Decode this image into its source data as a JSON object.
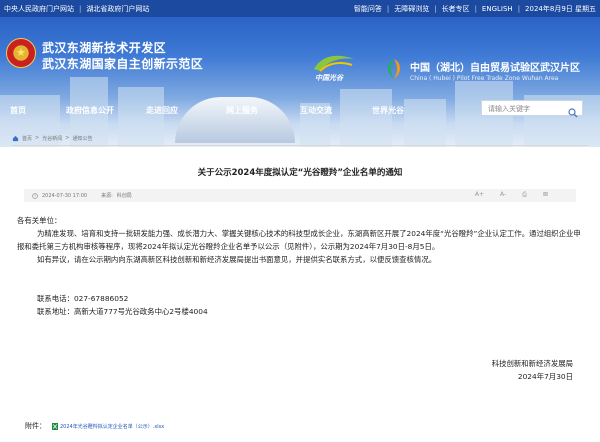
{
  "topbar": {
    "left_links": [
      "中央人民政府门户网站",
      "湖北省政府门户网站"
    ],
    "right_links": [
      "智能问答",
      "无障碍浏览",
      "长者专区",
      "ENGLISH"
    ],
    "date": "2024年8月9日 星期五"
  },
  "header": {
    "title_line1": "武汉东湖新技术开发区",
    "title_line2": "武汉东湖国家自主创新示范区",
    "optics_valley_logo_text": "中国光谷",
    "ftz_title": "中国（湖北）自由贸易试验区武汉片区",
    "ftz_subtitle": "China ( Hubei ) Pilot Free Trade Zone Wuhan Area",
    "emblem_star": "★"
  },
  "nav": {
    "items": [
      "首页",
      "政府信息公开",
      "走进回应",
      "网上服务",
      "互动交流",
      "世界光谷"
    ]
  },
  "search": {
    "placeholder": "请输入关键字"
  },
  "breadcrumb": [
    "首页",
    "光谷新闻",
    "通知公告"
  ],
  "article": {
    "title": "关于公示2024年度拟认定“光谷瞪羚”企业名单的通知",
    "date": "2024-07-30 17:00",
    "source_label": "来源:",
    "source": "科创局",
    "tools": [
      "A+",
      "A-",
      "⎙",
      "⊠"
    ],
    "salutation": "各有关单位：",
    "paragraph1": "为精准发现、培育和支持一批研发能力强、成长潜力大、掌握关键核心技术的科技型成长企业，东湖高新区开展了2024年度“光谷瞪羚”企业认定工作。通过组织企业申报和委托第三方机构审核等程序，现将2024年拟认定光谷瞪羚企业名单予以公示（见附件），公示期为2024年7月30日-8月5日。",
    "paragraph2": "如有异议，请在公示期内向东湖高新区科技创新和新经济发展局提出书面意见，并提供实名联系方式，以便反馈查核情况。",
    "contact_phone": "联系电话：027-67886052",
    "contact_address": "联系地址：高新大道777号光谷政务中心2号楼4004",
    "signature_org": "科技创新和新经济发展局",
    "signature_date": "2024年7月30日",
    "attachment_label": "附件：",
    "attachment_file": "2024年光谷瞪羚拟认定企业名单（公示）.xlsx"
  }
}
